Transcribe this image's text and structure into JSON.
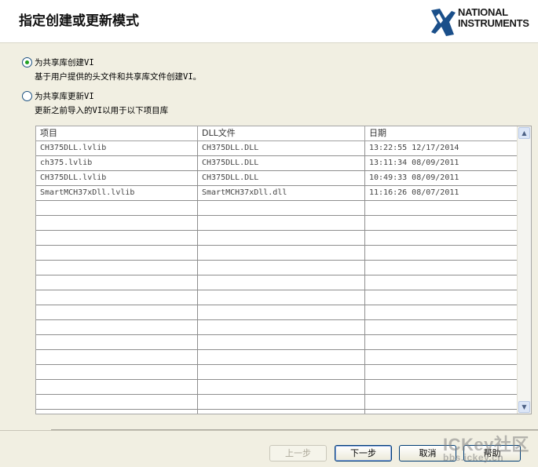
{
  "header": {
    "title": "指定创建或更新模式",
    "logo": {
      "line1": "NATIONAL",
      "line2": "INSTRUMENTS"
    }
  },
  "options": [
    {
      "label": "为共享库创建VI",
      "description": "基于用户提供的头文件和共享库文件创建VI。",
      "checked": true
    },
    {
      "label": "为共享库更新VI",
      "description": "更新之前导入的VI以用于以下项目库",
      "checked": false
    }
  ],
  "table": {
    "columns": [
      "项目",
      "DLL文件",
      "日期"
    ],
    "rows": [
      [
        "CH375DLL.lvlib",
        "CH375DLL.DLL",
        "13:22:55 12/17/2014"
      ],
      [
        "ch375.lvlib",
        "CH375DLL.DLL",
        "13:11:34 08/09/2011"
      ],
      [
        "CH375DLL.lvlib",
        "CH375DLL.DLL",
        "10:49:33 08/09/2011"
      ],
      [
        "SmartMCH37xDll.lvlib",
        "SmartMCH37xDll.dll",
        "11:16:26 08/07/2011"
      ],
      [
        "",
        "",
        ""
      ],
      [
        "",
        "",
        ""
      ],
      [
        "",
        "",
        ""
      ],
      [
        "",
        "",
        ""
      ],
      [
        "",
        "",
        ""
      ],
      [
        "",
        "",
        ""
      ],
      [
        "",
        "",
        ""
      ],
      [
        "",
        "",
        ""
      ],
      [
        "",
        "",
        ""
      ],
      [
        "",
        "",
        ""
      ],
      [
        "",
        "",
        ""
      ],
      [
        "",
        "",
        ""
      ],
      [
        "",
        "",
        ""
      ],
      [
        "",
        "",
        ""
      ],
      [
        "",
        "",
        ""
      ]
    ]
  },
  "buttons": {
    "prev": "上一步",
    "next": "下一步",
    "cancel": "取消",
    "help": "帮助"
  },
  "watermark": {
    "line1": "ICKey社区",
    "line2": "bbs.ickey.cn"
  },
  "colors": {
    "radio_selected": "#21a121",
    "logo_eagle": "#1a4f8a",
    "window_bg": "#f1efe2"
  }
}
